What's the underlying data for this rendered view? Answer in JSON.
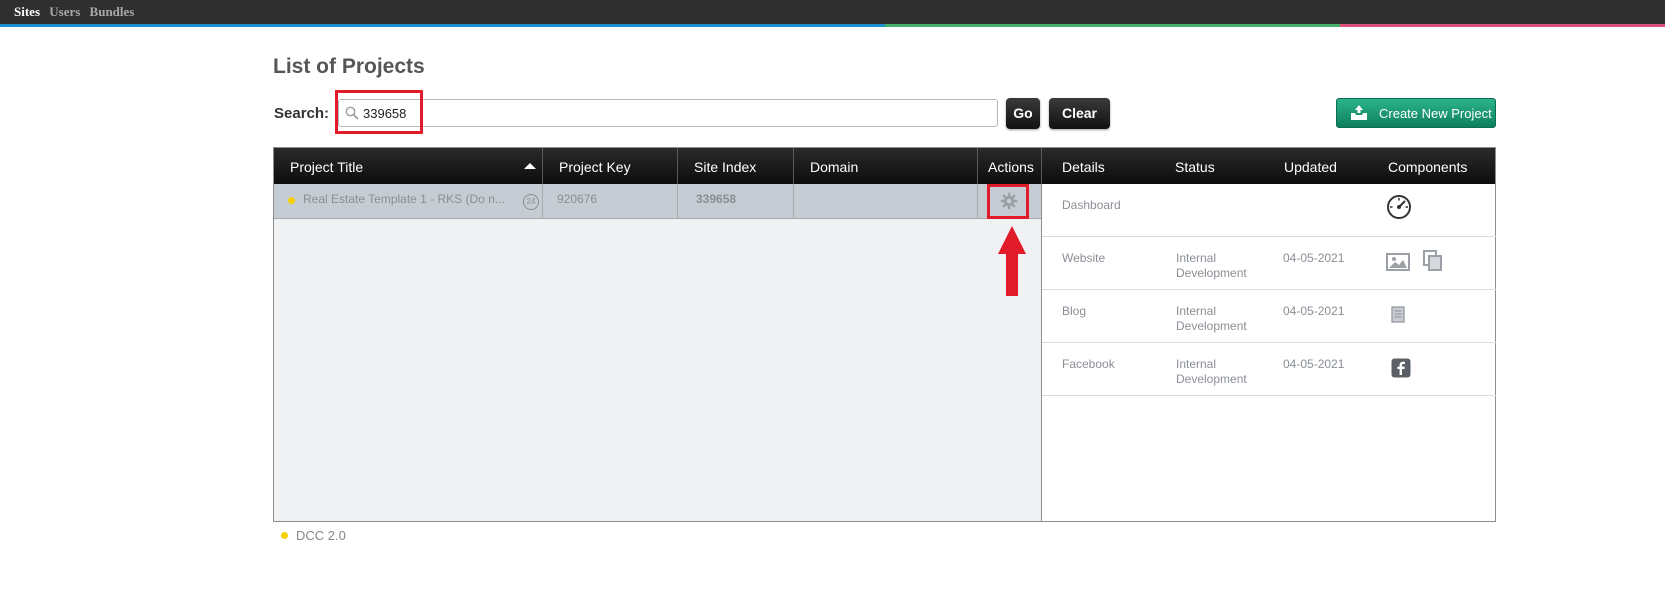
{
  "topnav": {
    "items": [
      "Sites",
      "Users",
      "Bundles"
    ],
    "active": "Sites"
  },
  "page": {
    "title": "List of Projects"
  },
  "search": {
    "label": "Search:",
    "value": "339658",
    "go_label": "Go",
    "clear_label": "Clear"
  },
  "create_button": {
    "label": "Create New Project"
  },
  "table": {
    "headers": {
      "project_title": "Project Title",
      "project_key": "Project Key",
      "site_index": "Site Index",
      "domain": "Domain",
      "actions": "Actions",
      "details": "Details",
      "status": "Status",
      "updated": "Updated",
      "components": "Components"
    },
    "rows": [
      {
        "title": "Real Estate Template 1 - RKS (Do n...",
        "badge": "24",
        "project_key": "920676",
        "site_index": "339658",
        "domain": "",
        "action_icon": "gear-icon"
      }
    ]
  },
  "components": [
    {
      "name": "Dashboard",
      "status": "",
      "updated": "",
      "icons": [
        "speedometer-icon"
      ]
    },
    {
      "name": "Website",
      "status": "Internal Development",
      "updated": "04-05-2021",
      "icons": [
        "image-icon",
        "copy-icon"
      ]
    },
    {
      "name": "Blog",
      "status": "Internal Development",
      "updated": "04-05-2021",
      "icons": [
        "document-icon"
      ]
    },
    {
      "name": "Facebook",
      "status": "Internal Development",
      "updated": "04-05-2021",
      "icons": [
        "facebook-icon"
      ]
    }
  ],
  "legend": {
    "label": "DCC 2.0",
    "color": "#f6d000"
  },
  "colors": {
    "highlight": "#e21b2a",
    "create_button": "#1a9a72",
    "row_selected": "#c6ccd3"
  }
}
